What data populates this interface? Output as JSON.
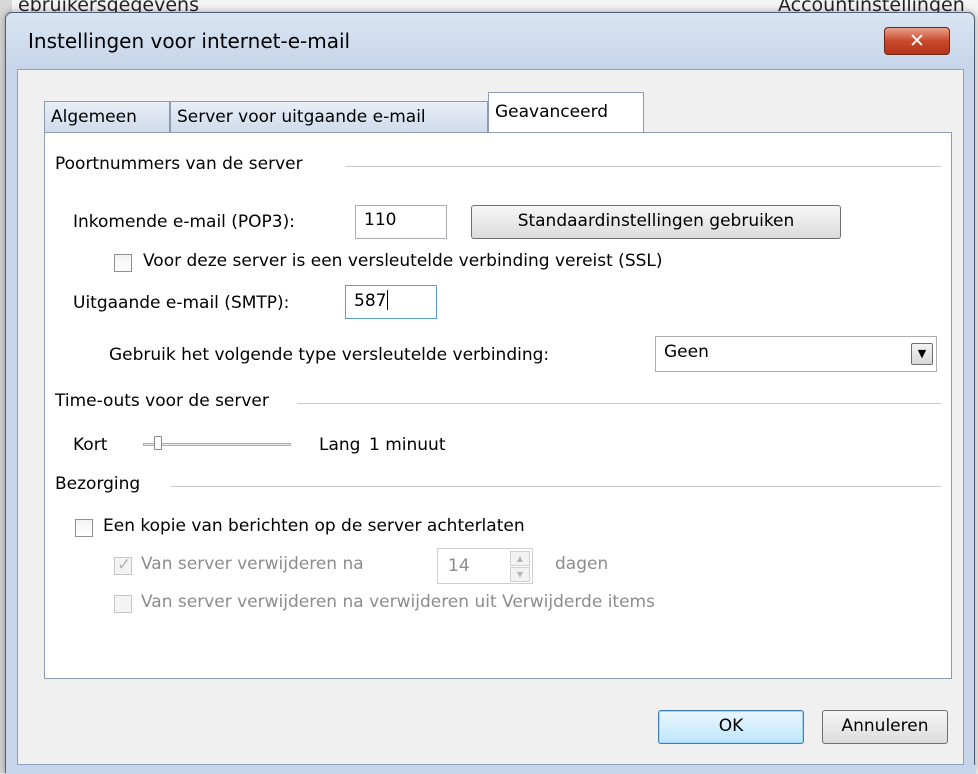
{
  "background": {
    "left_text": "ebruikersgegevens",
    "right_text": "Accountinstellingen"
  },
  "dialog": {
    "title": "Instellingen voor internet-e-mail",
    "close_glyph": "✕"
  },
  "tabs": [
    {
      "label": "Algemeen"
    },
    {
      "label": "Server voor uitgaande e-mail"
    },
    {
      "label": "Geavanceerd"
    }
  ],
  "ports": {
    "group_title": "Poortnummers van de server",
    "incoming_label": "Inkomende e-mail (POP3):",
    "incoming_value": "110",
    "defaults_button": "Standaardinstellingen gebruiken",
    "ssl_label": "Voor deze server is een versleutelde verbinding vereist (SSL)",
    "ssl_checked": false,
    "outgoing_label": "Uitgaande e-mail (SMTP):",
    "outgoing_value": "587",
    "encryption_label": "Gebruik het volgende type versleutelde verbinding:",
    "encryption_value": "Geen"
  },
  "timeouts": {
    "group_title": "Time-outs voor de server",
    "short_label": "Kort",
    "long_label": "Lang",
    "value_text": "1 minuut",
    "level": 0.1
  },
  "delivery": {
    "group_title": "Bezorging",
    "leave_copy_label": "Een kopie van berichten op de server achterlaten",
    "leave_copy_checked": false,
    "remove_after_label": "Van server verwijderen na",
    "remove_after_checked": true,
    "days_value": "14",
    "days_unit": "dagen",
    "remove_deleted_label": "Van server verwijderen na verwijderen uit Verwijderde items",
    "remove_deleted_checked": false
  },
  "footer": {
    "ok_label": "OK",
    "cancel_label": "Annuleren"
  },
  "colors": {
    "window_frame": "#c7d6ea",
    "close_button": "#c94a2b",
    "focus_border": "#5b9bd5"
  }
}
